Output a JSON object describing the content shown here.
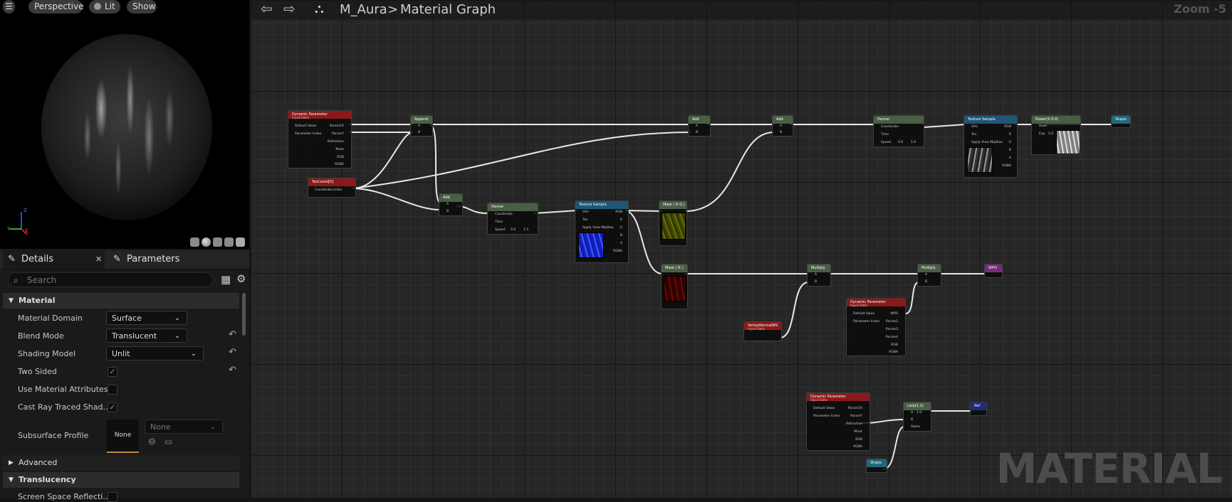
{
  "viewport": {
    "buttons": [
      "Perspective",
      "Lit",
      "Show"
    ],
    "axis": {
      "x": "X",
      "y": "Y",
      "z": "Z"
    }
  },
  "details": {
    "tabs": {
      "details": "Details",
      "parameters": "Parameters"
    },
    "search_placeholder": "Search",
    "sections": {
      "material": "Material",
      "advanced": "Advanced",
      "translucency": "Translucency"
    },
    "properties": {
      "material_domain": {
        "label": "Material Domain",
        "value": "Surface"
      },
      "blend_mode": {
        "label": "Blend Mode",
        "value": "Translucent"
      },
      "shading_model": {
        "label": "Shading Model",
        "value": "Unlit"
      },
      "two_sided": {
        "label": "Two Sided"
      },
      "use_material_attributes": {
        "label": "Use Material Attributes"
      },
      "cast_ray_traced": {
        "label": "Cast Ray Traced Shad..."
      },
      "subsurface_profile": {
        "label": "Subsurface Profile",
        "thumb": "None",
        "value": "None"
      },
      "screen_space": {
        "label": "Screen Space Reflecti..."
      }
    }
  },
  "graph": {
    "breadcrumb": {
      "asset": "M_Aura",
      "separator": ">",
      "graph": "Material Graph"
    },
    "zoom": "Zoom -5",
    "watermark": "MATERIAL",
    "nodes": {
      "dp1": {
        "title": "Dynamic Parameter",
        "sub": "Input Data",
        "pins": [
          "Default Value",
          "Parameter Index",
          "Param1X",
          "ParamY",
          "Refraction",
          "Mask",
          "RGB",
          "RGBA"
        ]
      },
      "texcoord": {
        "title": "TexCoord[0]",
        "pins": [
          "Coordinate Index"
        ]
      },
      "append": {
        "title": "Append",
        "pins": [
          "A",
          "B"
        ]
      },
      "add_top1": {
        "title": "Add",
        "pins": [
          "A",
          "B"
        ]
      },
      "add_top2": {
        "title": "Add",
        "pins": [
          "A",
          "B"
        ]
      },
      "panner_top": {
        "title": "Panner",
        "pins": [
          "Coordinate",
          "Time",
          "Speed",
          "0.0",
          "1.0"
        ]
      },
      "tex_top": {
        "title": "Texture Sample",
        "pins": [
          "UVs",
          "Tex",
          "Apply View MipBias",
          "RGB",
          "R",
          "G",
          "B",
          "A",
          "RGBA"
        ]
      },
      "power": {
        "title": "Power(X,5.0)",
        "pins": [
          "Base",
          "Exp",
          "5.0"
        ]
      },
      "shape_top": {
        "title": "Shape"
      },
      "add_mid": {
        "title": "Add",
        "pins": [
          "A",
          "B"
        ]
      },
      "panner_mid": {
        "title": "Panner",
        "pins": [
          "Coordinate",
          "Time",
          "Speed",
          "0.0",
          "1.5"
        ]
      },
      "tex_mid": {
        "title": "Texture Sample",
        "pins": [
          "UVs",
          "Tex",
          "Apply View MipBias",
          "RGB",
          "R",
          "G",
          "B",
          "A",
          "RGBA"
        ]
      },
      "mask_rg": {
        "title": "Mask ( R G )"
      },
      "mask_r": {
        "title": "Mask ( R )"
      },
      "mult1": {
        "title": "Multiply",
        "pins": [
          "A",
          "B"
        ]
      },
      "mult2": {
        "title": "Multiply",
        "pins": [
          "A",
          "B"
        ]
      },
      "wpo": {
        "title": "WPO"
      },
      "dp2": {
        "title": "Dynamic Parameter",
        "sub": "Input Data",
        "pins": [
          "Default Value",
          "Parameter Index",
          "Param2",
          "Param3",
          "Param4",
          "WPO",
          "RGB",
          "RGBA"
        ]
      },
      "vnormal": {
        "title": "VertexNormalWS",
        "sub": "Input Data"
      },
      "dp3": {
        "title": "Dynamic Parameter",
        "sub": "Input Data",
        "pins": [
          "Default Value",
          "Parameter Index",
          "Param1X",
          "ParamY",
          "Refraction",
          "Mask",
          "RGB",
          "RGBA"
        ]
      },
      "lerp": {
        "title": "Lerp(1,2)",
        "pins": [
          "A",
          "1.0",
          "B",
          "Alpha"
        ]
      },
      "ref": {
        "title": "Ref"
      },
      "shape_bot": {
        "title": "Shape"
      }
    }
  }
}
